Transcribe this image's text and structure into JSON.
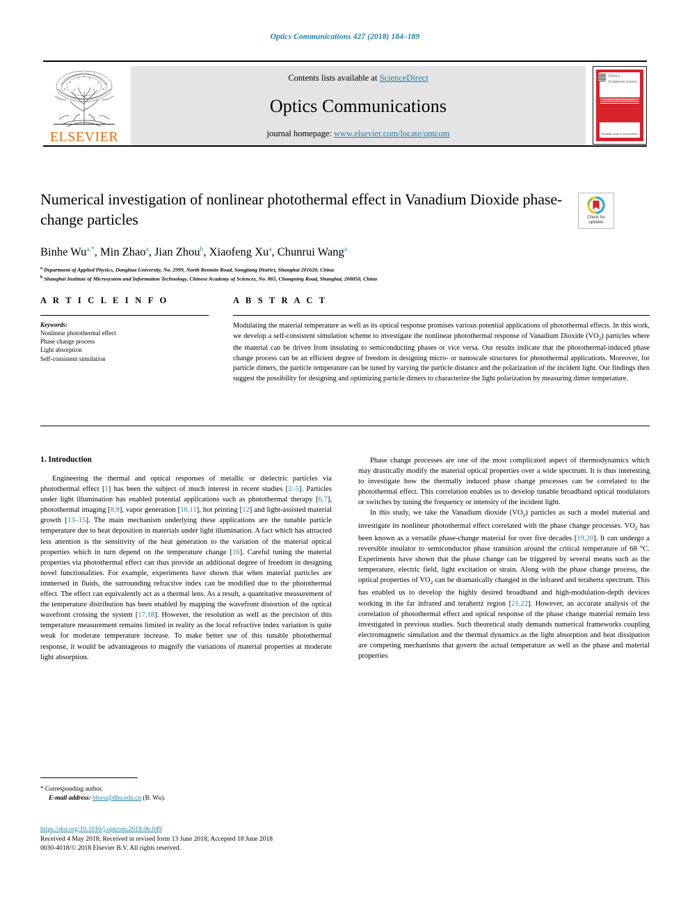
{
  "running_head": "Optics Communications 427 (2018) 184–189",
  "masthead": {
    "contents_prefix": "Contents lists available at ",
    "contents_link": "ScienceDirect",
    "journal_title": "Optics Communications",
    "homepage_prefix": "journal homepage: ",
    "homepage_link": "www.elsevier.com/locate/optcom",
    "publisher_wordmark": "ELSEVIER",
    "cover": {
      "title_line1": "Optics",
      "title_line2": "Communications",
      "strap": "a journal of optics and photonics",
      "footer_text": "Available online at ScienceDirect"
    }
  },
  "article": {
    "title": "Numerical investigation of nonlinear photothermal effect in Vanadium Dioxide phase-change particles",
    "authors": [
      {
        "name": "Binhe Wu",
        "marks": "a,*"
      },
      {
        "name": "Min Zhao",
        "marks": "a"
      },
      {
        "name": "Jian Zhou",
        "marks": "b"
      },
      {
        "name": "Xiaofeng Xu",
        "marks": "a"
      },
      {
        "name": "Chunrui Wang",
        "marks": "a"
      }
    ],
    "affiliations": [
      {
        "mark": "a",
        "text": "Department of Applied Physics, Donghua University, No. 2999, North Renmin Road, Songjiang District, Shanghai 201620, China"
      },
      {
        "mark": "b",
        "text": "Shanghai Institute of Microsystem and Information Technology, Chinese Academy of Sciences, No. 865, Changning Road, Shanghai, 200050, China"
      }
    ],
    "crossmark": {
      "line1": "Check for",
      "line2": "updates"
    }
  },
  "article_info": {
    "heading": "A R T I C L E   I N F O",
    "keywords_label": "Keywords:",
    "keywords": [
      "Nonlinear photothermal effect",
      "Phase change process",
      "Light absorption",
      "Self-consistent simulation"
    ]
  },
  "abstract": {
    "heading": "A B S T R A C T",
    "text": "Modulating the material temperature as well as its optical response promises various potential applications of photothermal effects. In this work, we develop a self-consistent simulation scheme to investigate the nonlinear photothermal response of Vanadium Dioxide (VO2) particles where the material can be driven from insulating to semiconducting phases or vice versa. Our results indicate that the photothermal-induced phase change process can be an efficient degree of freedom in designing micro- or nanoscale structures for photothermal applications. Moreover, for particle dimers, the particle temperature can be tuned by varying the particle distance and the polarization of the incident light. Our findings then suggest the possibility for designing and optimizing particle dimers to characterize the light polarization by measuring dimer temperature."
  },
  "body": {
    "section_title": "1. Introduction",
    "left_paragraphs": [
      "Engineering the thermal and optical responses of metallic or dielectric particles via photothermal effect [1] has been the subject of much interest in recent studies [2–5]. Particles under light illumination has enabled potential applications such as photothermal therapy [6,7], photothermal imaging [8,9], vapor generation [10,11], hot printing [12] and light-assisted material growth [13–15]. The main mechanism underlying these applications are the tunable particle temperature due to heat deposition in materials under light illumination. A fact which has attracted less attention is the sensitivity of the heat generation to the variation of the material optical properties which in turn depend on the temperature change [16]. Careful tuning the material properties via photothermal effect can thus provide an additional degree of freedom in designing novel functionalities. For example, experiments have shown that when material particles are immersed in fluids, the surrounding refractive index can be modified due to the photothermal effect. The effect can equivalently act as a thermal lens. As a result, a quantitative measurement of the temperature distribution has been enabled by mapping the wavefront distortion of the optical wavefront crossing the system [17,18]. However, the resolution as well as the precision of this temperature measurement remains limited in reality as the local refractive index variation is quite weak for moderate temperature increase. To make better use of this tunable photothermal response, it would be advantageous to magnify the variations of material properties at moderate light absorption."
    ],
    "right_paragraphs": [
      "Phase change processes are one of the most complicated aspect of thermodynamics which may drastically modify the material optical properties over a wide spectrum. It is thus interesting to investigate how the thermally induced phase change processes can be correlated to the photothermal effect. This correlation enables us to develop tunable broadband optical modulators or switches by tuning the frequency or intensity of the incident light.",
      "In this study, we take the Vanadium dioxide (VO2) particles as such a model material and investigate its nonlinear photothermal effect correlated with the phase change processes. VO2 has been known as a versatile phase-change material for over five decades [19,20]. It can undergo a reversible insulator to semiconductor phase transition around the critical temperature of 68 °C. Experiments have shown that the phase change can be triggered by several means such as the temperature, electric field, light excitation or strain. Along with the phase change process, the optical properties of VO2 can be dramatically changed in the infrared and terahertz spectrum. This has enabled us to develop the highly desired broadband and high-modulation-depth devices working in the far infrared and terahertz region [21,22]. However, an accurate analysis of the correlation of photothermal effect and optical response of the phase change material remain less investigated in previous studies. Such theoretical study demands numerical frameworks coupling electromagnetic simulation and the thermal dynamics as the light absorption and heat dissipation are competing mechanisms that govern the actual temperature as well as the phase and material properties"
    ]
  },
  "footnote": {
    "star": "*",
    "corresponding": "Corresponding author.",
    "email_label": "E-mail address:",
    "email": "bhwu@dhu.edu.cn",
    "email_suffix": "(B. Wu)."
  },
  "footer": {
    "doi": "https://doi.org/10.1016/j.optcom.2018.06.049",
    "dates": "Received 4 May 2018; Received in revised form 13 June 2018; Accepted 18 June 2018",
    "copyright": "0030-4018/© 2018 Elsevier B.V. All rights reserved."
  },
  "colors": {
    "link": "#1b7fa8",
    "elsevier_orange": "#f06c00",
    "cover_red": "#d8232a",
    "band_gray": "#e4e4e4"
  }
}
